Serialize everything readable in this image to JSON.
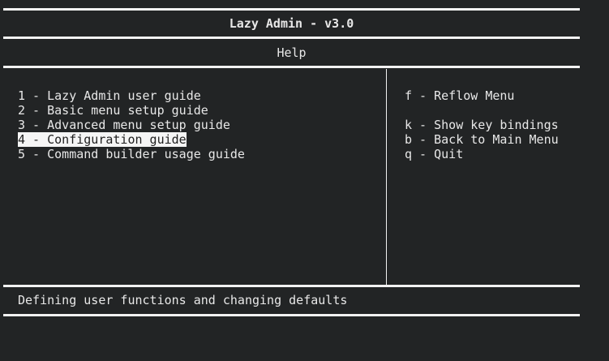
{
  "app": {
    "title": "Lazy Admin - v3.0",
    "subtitle": "Help"
  },
  "menu": {
    "selected_index": 3,
    "items": [
      {
        "label": "1 - Lazy Admin user guide"
      },
      {
        "label": "2 - Basic menu setup guide"
      },
      {
        "label": "3 - Advanced menu setup guide"
      },
      {
        "label": "4 - Configuration guide"
      },
      {
        "label": "5 - Command builder usage guide"
      }
    ]
  },
  "keys": {
    "reflow": "f - Reflow Menu",
    "show_bindings": "k - Show key bindings",
    "back": "b - Back to Main Menu",
    "quit": "q - Quit"
  },
  "status": {
    "description": "Defining user functions and changing defaults"
  },
  "colors": {
    "background": "#222425",
    "foreground": "#e8e8e8",
    "selection_bg": "#f5f5f5",
    "selection_fg": "#1e1e1e"
  }
}
